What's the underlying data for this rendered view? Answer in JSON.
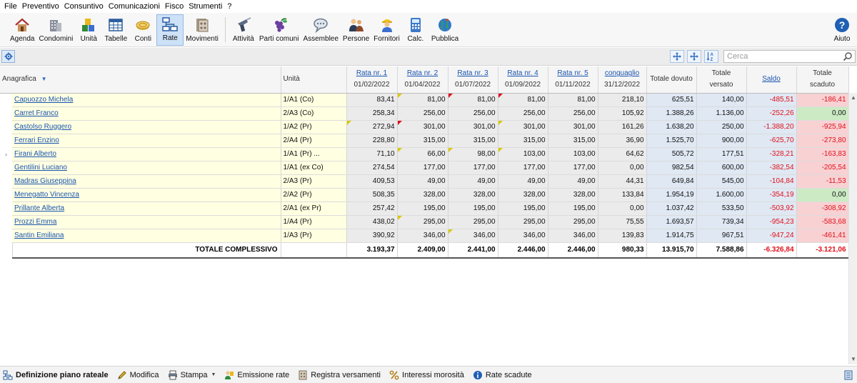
{
  "menu": [
    "File",
    "Preventivo",
    "Consuntivo",
    "Comunicazioni",
    "Fisco",
    "Strumenti",
    "?"
  ],
  "toolbar": {
    "group1": [
      {
        "label": "Agenda",
        "icon": "house-icon"
      },
      {
        "label": "Condomini",
        "icon": "building-icon"
      },
      {
        "label": "Unità",
        "icon": "blocks-icon"
      },
      {
        "label": "Tabelle",
        "icon": "table-icon"
      },
      {
        "label": "Conti",
        "icon": "coins-icon"
      },
      {
        "label": "Rate",
        "icon": "network-icon",
        "active": true
      },
      {
        "label": "Movimenti",
        "icon": "ledger-icon"
      }
    ],
    "group2": [
      {
        "label": "Attività",
        "icon": "drill-icon"
      },
      {
        "label": "Parti comuni",
        "icon": "grapes-icon"
      },
      {
        "label": "Assemblee",
        "icon": "speech-icon"
      },
      {
        "label": "Persone",
        "icon": "people-icon"
      },
      {
        "label": "Fornitori",
        "icon": "worker-icon"
      },
      {
        "label": "Calc.",
        "icon": "calculator-icon"
      },
      {
        "label": "Pubblica",
        "icon": "globe-icon"
      }
    ],
    "help": {
      "label": "Aiuto",
      "icon": "help-icon"
    }
  },
  "search": {
    "placeholder": "Cerca",
    "value": ""
  },
  "columns": {
    "anagrafica": "Anagrafica",
    "unita": "Unità",
    "rate": [
      {
        "title": "Rata nr. 1",
        "date": "01/02/2022"
      },
      {
        "title": "Rata nr. 2",
        "date": "01/04/2022"
      },
      {
        "title": "Rata nr. 3",
        "date": "01/07/2022"
      },
      {
        "title": "Rata nr. 4",
        "date": "01/09/2022"
      },
      {
        "title": "Rata nr. 5",
        "date": "01/11/2022"
      },
      {
        "title": "conguaglio",
        "date": "31/12/2022"
      }
    ],
    "totale_dovuto": "Totale dovuto",
    "totale_versato_1": "Totale",
    "totale_versato_2": "versato",
    "saldo": "Saldo",
    "totale_scaduto_1": "Totale",
    "totale_scaduto_2": "scaduto"
  },
  "rows": [
    {
      "name": "Capuozzo Michela",
      "unit": "1/A1 (Co)",
      "r": [
        "83,41",
        "81,00",
        "81,00",
        "81,00",
        "81,00",
        "218,10"
      ],
      "corners": [
        "",
        "y",
        "r",
        "r",
        "",
        ""
      ],
      "dovuto": "625,51",
      "versato": "140,00",
      "saldo": "-485,51",
      "scaduto": "-186,41",
      "scaduto_status": "neg"
    },
    {
      "name": "Carret Franco",
      "unit": "2/A3 (Co)",
      "r": [
        "258,34",
        "256,00",
        "256,00",
        "256,00",
        "256,00",
        "105,92"
      ],
      "corners": [
        "",
        "",
        "",
        "",
        "",
        ""
      ],
      "dovuto": "1.388,26",
      "versato": "1.136,00",
      "saldo": "-252,26",
      "scaduto": "0,00",
      "scaduto_status": "ok"
    },
    {
      "name": "Castolso Ruggero",
      "unit": "1/A2 (Pr)",
      "r": [
        "272,94",
        "301,00",
        "301,00",
        "301,00",
        "301,00",
        "161,26"
      ],
      "corners": [
        "y",
        "r",
        "",
        "y",
        "",
        ""
      ],
      "dovuto": "1.638,20",
      "versato": "250,00",
      "saldo": "-1.388,20",
      "scaduto": "-925,94",
      "scaduto_status": "neg"
    },
    {
      "name": "Ferrari Enzino",
      "unit": "2/A4 (Pr)",
      "r": [
        "228,80",
        "315,00",
        "315,00",
        "315,00",
        "315,00",
        "36,90"
      ],
      "corners": [
        "",
        "",
        "",
        "",
        "",
        ""
      ],
      "dovuto": "1.525,70",
      "versato": "900,00",
      "saldo": "-625,70",
      "scaduto": "-273,80",
      "scaduto_status": "neg"
    },
    {
      "name": "Firani Alberto",
      "unit": "1/A1 (Pr) ...",
      "r": [
        "71,10",
        "66,00",
        "98,00",
        "103,00",
        "103,00",
        "64,62"
      ],
      "corners": [
        "",
        "y",
        "y",
        "y",
        "",
        ""
      ],
      "dovuto": "505,72",
      "versato": "177,51",
      "saldo": "-328,21",
      "scaduto": "-163,83",
      "scaduto_status": "neg"
    },
    {
      "name": "Gentilini Luciano",
      "unit": "1/A1 (ex Co)",
      "r": [
        "274,54",
        "177,00",
        "177,00",
        "177,00",
        "177,00",
        "0,00"
      ],
      "corners": [
        "",
        "",
        "",
        "",
        "",
        ""
      ],
      "dovuto": "982,54",
      "versato": "600,00",
      "saldo": "-382,54",
      "scaduto": "-205,54",
      "scaduto_status": "neg"
    },
    {
      "name": "Madras Giuseppina",
      "unit": "2/A3 (Pr)",
      "r": [
        "409,53",
        "49,00",
        "49,00",
        "49,00",
        "49,00",
        "44,31"
      ],
      "corners": [
        "",
        "",
        "",
        "",
        "",
        ""
      ],
      "dovuto": "649,84",
      "versato": "545,00",
      "saldo": "-104,84",
      "scaduto": "-11,53",
      "scaduto_status": "neg"
    },
    {
      "name": "Menegatto Vincenza",
      "unit": "2/A2 (Pr)",
      "r": [
        "508,35",
        "328,00",
        "328,00",
        "328,00",
        "328,00",
        "133,84"
      ],
      "corners": [
        "",
        "",
        "",
        "",
        "",
        ""
      ],
      "dovuto": "1.954,19",
      "versato": "1.600,00",
      "saldo": "-354,19",
      "scaduto": "0,00",
      "scaduto_status": "ok"
    },
    {
      "name": "Prillante Alberta",
      "unit": "2/A1 (ex Pr)",
      "r": [
        "257,42",
        "195,00",
        "195,00",
        "195,00",
        "195,00",
        "0,00"
      ],
      "corners": [
        "",
        "",
        "",
        "",
        "",
        ""
      ],
      "dovuto": "1.037,42",
      "versato": "533,50",
      "saldo": "-503,92",
      "scaduto": "-308,92",
      "scaduto_status": "neg"
    },
    {
      "name": "Prozzi Emma",
      "unit": "1/A4 (Pr)",
      "r": [
        "438,02",
        "295,00",
        "295,00",
        "295,00",
        "295,00",
        "75,55"
      ],
      "corners": [
        "",
        "y",
        "",
        "",
        "",
        ""
      ],
      "dovuto": "1.693,57",
      "versato": "739,34",
      "saldo": "-954,23",
      "scaduto": "-583,68",
      "scaduto_status": "neg"
    },
    {
      "name": "Santin Emiliana",
      "unit": "1/A3 (Pr)",
      "r": [
        "390,92",
        "346,00",
        "346,00",
        "346,00",
        "346,00",
        "139,83"
      ],
      "corners": [
        "",
        "",
        "y",
        "",
        "",
        ""
      ],
      "dovuto": "1.914,75",
      "versato": "967,51",
      "saldo": "-947,24",
      "scaduto": "-461,41",
      "scaduto_status": "neg"
    }
  ],
  "current_row_marker": "›",
  "current_row_index": 4,
  "total": {
    "label": "TOTALE COMPLESSIVO",
    "r": [
      "3.193,37",
      "2.409,00",
      "2.441,00",
      "2.446,00",
      "2.446,00",
      "980,33"
    ],
    "dovuto": "13.915,70",
    "versato": "7.588,86",
    "saldo": "-6.326,84",
    "scaduto": "-3.121,06"
  },
  "bottombar": [
    {
      "label": "Definizione piano rateale",
      "icon": "plan-icon",
      "strong": true
    },
    {
      "label": "Modifica",
      "icon": "pencil-icon"
    },
    {
      "label": "Stampa",
      "icon": "print-icon",
      "dropdown": true
    },
    {
      "label": "Emissione rate",
      "icon": "issue-icon"
    },
    {
      "label": "Registra versamenti",
      "icon": "register-icon"
    },
    {
      "label": "Interessi morosità",
      "icon": "percent-icon"
    },
    {
      "label": "Rate scadute",
      "icon": "info-icon"
    }
  ],
  "colors": {
    "accent": "#1a55b0",
    "negative": "#e0101a",
    "yellow_cell": "#ffffe1",
    "blue_cell": "#dfe8f3",
    "pink_cell": "#f8d1d3",
    "green_cell": "#ccebc4"
  }
}
